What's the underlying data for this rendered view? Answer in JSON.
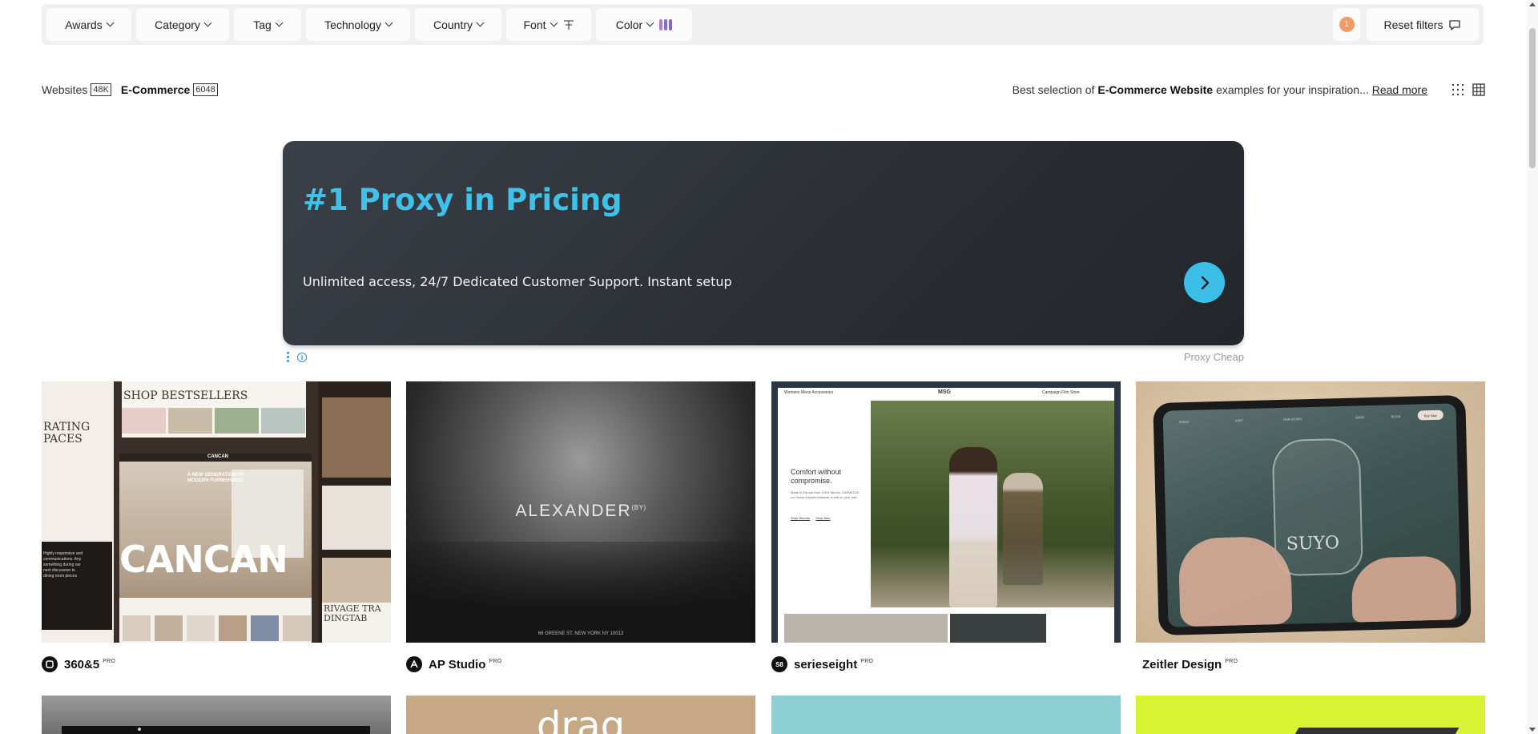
{
  "filters": {
    "awards": "Awards",
    "category": "Category",
    "tag": "Tag",
    "technology": "Technology",
    "country": "Country",
    "font": "Font",
    "color": "Color",
    "active_count": "1",
    "reset": "Reset filters",
    "color_swatches": [
      "#b07bd6",
      "#7b6fd8",
      "#8a63c9"
    ]
  },
  "breadcrumb": {
    "websites": "Websites",
    "websites_count": "48K",
    "ecommerce": "E-Commerce",
    "ecommerce_count": "6048"
  },
  "intro": {
    "prefix": "Best selection of",
    "bold": "E-Commerce Website",
    "suffix": "examples for your inspiration...",
    "read_more": "Read more"
  },
  "ad": {
    "title": "#1 Proxy in Pricing",
    "subtitle": "Unlimited access, 24/7 Dedicated Customer Support. Instant setup",
    "sponsor": "Proxy Cheap",
    "info": "i"
  },
  "cards": [
    {
      "name": "360&5",
      "badge": "PRO",
      "logo": "◐",
      "thumb": {
        "headline": "SHOP BESTSELLERS",
        "left_text": "RATING\nPACES",
        "brand": "CANCAN",
        "hero_text": "A NEW GENERATION OF\nMODERN FURNISHINGS",
        "nav_brand": "CANCAN",
        "bottom_right": "RIVAGE TRA\nDINGTAB"
      }
    },
    {
      "name": "AP Studio",
      "badge": "PRO",
      "logo": "AP",
      "thumb": {
        "brand": "ALEXANDER",
        "brand_sup": "(BY)",
        "address": "66 GREENE ST, NEW YORK NY 10013"
      }
    },
    {
      "name": "serieseight",
      "badge": "PRO",
      "logo": "S8",
      "thumb": {
        "nav_brand": "MSG",
        "nav_left": "Womens  Mens  Accessories",
        "nav_right": "Campaign  Film  Store",
        "headline": "Comfort without\ncompromise.",
        "body": "Made in Europe from 100% Merino. DARWOOD, our Swiss inspired knitwear is soft on your skin.",
        "cta1": "Shop Women",
        "cta2": "Shop Men"
      }
    },
    {
      "name": "Zeitler Design",
      "badge": "PRO",
      "logo": "",
      "thumb": {
        "brand": "SUYO",
        "menu": [
          "PISCO",
          "VISIT",
          "OUR STORY",
          "SHOP",
          "BOOK"
        ],
        "pill": "Buy Now"
      }
    }
  ],
  "row2": {
    "card2_word": "drag"
  }
}
